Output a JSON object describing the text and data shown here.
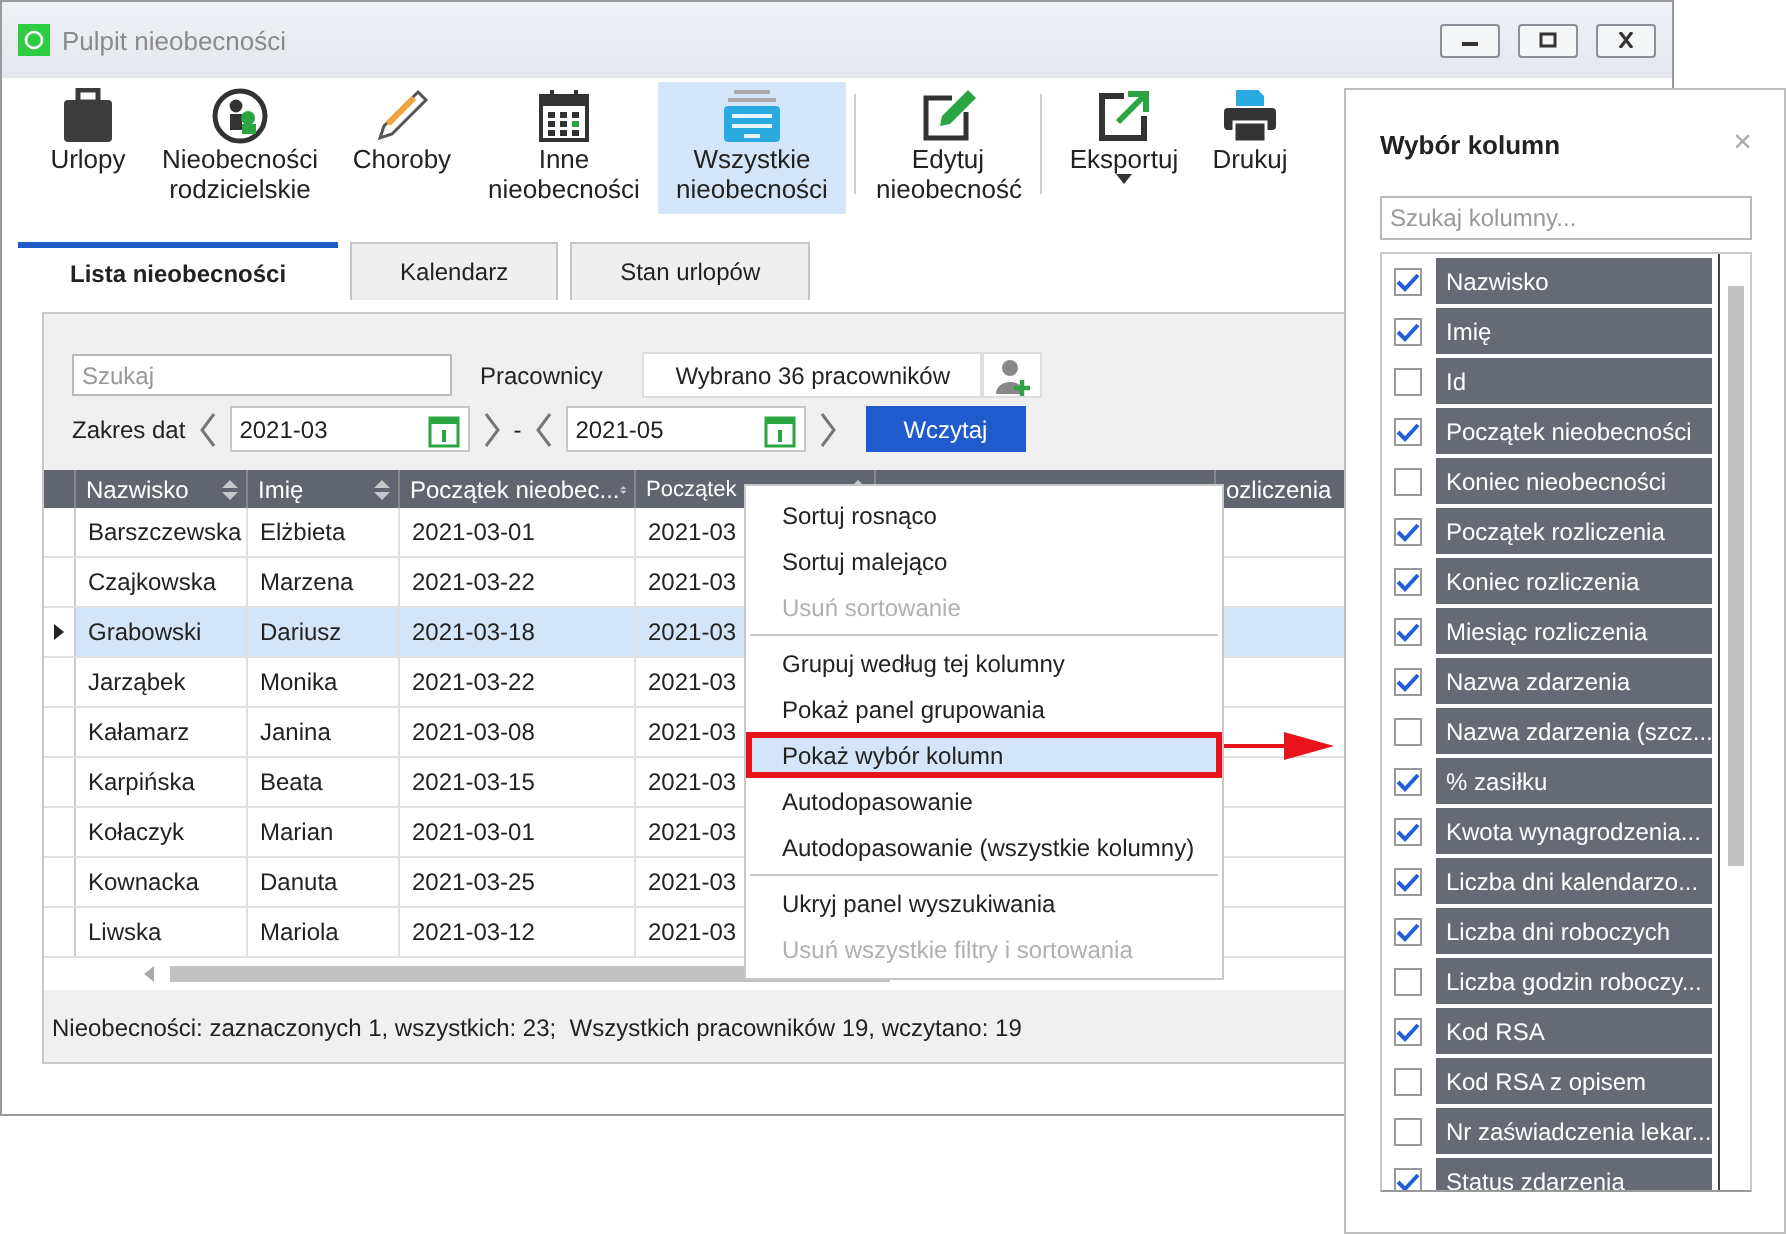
{
  "window": {
    "title": "Pulpit nieobecności"
  },
  "toolbar": [
    {
      "kind": "button",
      "label": "Urlopy",
      "selected": false
    },
    {
      "kind": "button",
      "label": "Nieobecności rodzicielskie",
      "selected": false
    },
    {
      "kind": "button",
      "label": "Choroby",
      "selected": false
    },
    {
      "kind": "button",
      "label": "Inne nieobecności",
      "selected": false
    },
    {
      "kind": "button",
      "label": "Wszystkie nieobecności",
      "selected": true
    },
    {
      "kind": "separator"
    },
    {
      "kind": "button",
      "label": "Edytuj nieobecność",
      "selected": false
    },
    {
      "kind": "separator"
    },
    {
      "kind": "dropdown",
      "label": "Eksportuj",
      "selected": false
    },
    {
      "kind": "button",
      "label": "Drukuj",
      "selected": false
    }
  ],
  "tabs": [
    {
      "label": "Lista nieobecności",
      "selected": true
    },
    {
      "label": "Kalendarz",
      "selected": false
    },
    {
      "label": "Stan urlopów",
      "selected": false
    }
  ],
  "filters": {
    "search": {
      "placeholder": "Szukaj"
    },
    "employees_label": "Pracownicy",
    "employees_value": "Wybrano 36 pracowników",
    "date_label": "Zakres dat",
    "date_from": "2021-03",
    "date_separator": "-",
    "date_to": "2021-05",
    "load_button": "Wczytaj"
  },
  "table": {
    "columns": [
      "Nazwisko",
      "Imię",
      "Początek nieobec...",
      "Początek",
      "",
      "ozliczenia"
    ],
    "rows": [
      {
        "cells": [
          "Barszczewska",
          "Elżbieta",
          "2021-03-01",
          "2021-03"
        ],
        "selected": false
      },
      {
        "cells": [
          "Czajkowska",
          "Marzena",
          "2021-03-22",
          "2021-03"
        ],
        "selected": false
      },
      {
        "cells": [
          "Grabowski",
          "Dariusz",
          "2021-03-18",
          "2021-03"
        ],
        "selected": true
      },
      {
        "cells": [
          "Jarząbek",
          "Monika",
          "2021-03-22",
          "2021-03"
        ],
        "selected": false
      },
      {
        "cells": [
          "Kałamarz",
          "Janina",
          "2021-03-08",
          "2021-03"
        ],
        "selected": false
      },
      {
        "cells": [
          "Karpińska",
          "Beata",
          "2021-03-15",
          "2021-03"
        ],
        "selected": false
      },
      {
        "cells": [
          "Kołaczyk",
          "Marian",
          "2021-03-01",
          "2021-03"
        ],
        "selected": false
      },
      {
        "cells": [
          "Kownacka",
          "Danuta",
          "2021-03-25",
          "2021-03"
        ],
        "selected": false
      },
      {
        "cells": [
          "Liwska",
          "Mariola",
          "2021-03-12",
          "2021-03"
        ],
        "selected": false
      }
    ]
  },
  "context_menu": [
    {
      "kind": "item",
      "label": "Sortuj rosnąco",
      "disabled": false,
      "selected": false
    },
    {
      "kind": "item",
      "label": "Sortuj malejąco",
      "disabled": false,
      "selected": false
    },
    {
      "kind": "item",
      "label": "Usuń sortowanie",
      "disabled": true,
      "selected": false
    },
    {
      "kind": "separator"
    },
    {
      "kind": "item",
      "label": "Grupuj według tej kolumny",
      "disabled": false,
      "selected": false
    },
    {
      "kind": "item",
      "label": "Pokaż panel grupowania",
      "disabled": false,
      "selected": false
    },
    {
      "kind": "item",
      "label": "Pokaż wybór kolumn",
      "disabled": false,
      "selected": true
    },
    {
      "kind": "item",
      "label": "Autodopasowanie",
      "disabled": false,
      "selected": false
    },
    {
      "kind": "item",
      "label": "Autodopasowanie (wszystkie kolumny)",
      "disabled": false,
      "selected": false
    },
    {
      "kind": "separator"
    },
    {
      "kind": "item",
      "label": "Ukryj panel wyszukiwania",
      "disabled": false,
      "selected": false
    },
    {
      "kind": "item",
      "label": "Usuń wszystkie filtry i sortowania",
      "disabled": true,
      "selected": false
    }
  ],
  "status_bar": "Nieobecności: zaznaczonych 1, wszystkich: 23;  Wszystkich pracowników 19, wczytano: 19",
  "column_chooser": {
    "title": "Wybór kolumn",
    "close": "×",
    "search": {
      "placeholder": "Szukaj kolumny..."
    },
    "columns": [
      {
        "label": "Nazwisko",
        "checked": true
      },
      {
        "label": "Imię",
        "checked": true
      },
      {
        "label": "Id",
        "checked": false
      },
      {
        "label": "Początek nieobecności",
        "checked": true
      },
      {
        "label": "Koniec nieobecności",
        "checked": false
      },
      {
        "label": "Początek rozliczenia",
        "checked": true
      },
      {
        "label": "Koniec rozliczenia",
        "checked": true
      },
      {
        "label": "Miesiąc rozliczenia",
        "checked": true
      },
      {
        "label": "Nazwa zdarzenia",
        "checked": true
      },
      {
        "label": "Nazwa zdarzenia (szcz...",
        "checked": false
      },
      {
        "label": "% zasiłku",
        "checked": true
      },
      {
        "label": "Kwota wynagrodzenia...",
        "checked": true
      },
      {
        "label": "Liczba dni kalendarzo...",
        "checked": true
      },
      {
        "label": "Liczba dni roboczych",
        "checked": true
      },
      {
        "label": "Liczba godzin roboczy...",
        "checked": false
      },
      {
        "label": "Kod RSA",
        "checked": true
      },
      {
        "label": "Kod RSA z opisem",
        "checked": false
      },
      {
        "label": "Nr zaświadczenia lekar...",
        "checked": false
      },
      {
        "label": "Status zdarzenia",
        "checked": true
      }
    ]
  }
}
